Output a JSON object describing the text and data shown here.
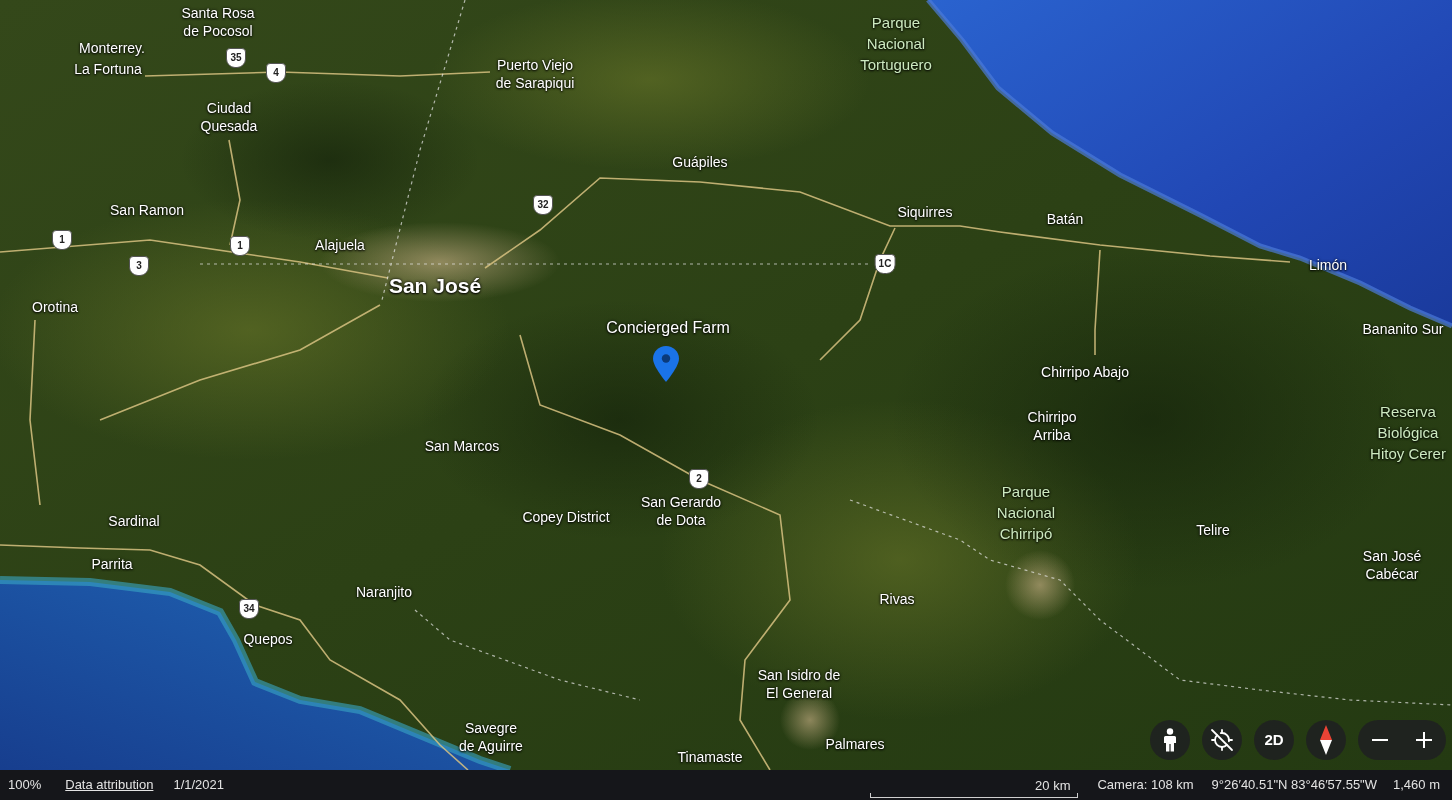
{
  "map": {
    "place_labels": [
      {
        "kind": "place",
        "lines": [
          "Santa Rosa",
          "de Pocosol"
        ]
      },
      {
        "kind": "place",
        "lines": [
          "Monterrey."
        ]
      },
      {
        "kind": "place",
        "lines": [
          "La Fortuna"
        ]
      },
      {
        "kind": "place",
        "lines": [
          "Puerto Viejo",
          "de Sarapiqui"
        ]
      },
      {
        "kind": "park",
        "lines": [
          "Parque",
          "Nacional",
          "Tortuguero"
        ]
      },
      {
        "kind": "place",
        "lines": [
          "Ciudad",
          "Quesada"
        ]
      },
      {
        "kind": "place",
        "lines": [
          "Guápiles"
        ]
      },
      {
        "kind": "place",
        "lines": [
          "San Ramon"
        ]
      },
      {
        "kind": "place",
        "lines": [
          "Siquirres"
        ]
      },
      {
        "kind": "place",
        "lines": [
          "Batán"
        ]
      },
      {
        "kind": "place",
        "lines": [
          "Alajuela"
        ]
      },
      {
        "kind": "place",
        "lines": [
          "Limón"
        ]
      },
      {
        "kind": "city",
        "lines": [
          "San José"
        ]
      },
      {
        "kind": "place",
        "lines": [
          "Orotina"
        ]
      },
      {
        "kind": "pinned",
        "lines": [
          "Concierged Farm"
        ]
      },
      {
        "kind": "place",
        "lines": [
          "Bananito Sur"
        ]
      },
      {
        "kind": "place",
        "lines": [
          "Chirripo Abajo"
        ]
      },
      {
        "kind": "place",
        "lines": [
          "San Marcos"
        ]
      },
      {
        "kind": "place",
        "lines": [
          "Chirripo",
          "Arriba"
        ]
      },
      {
        "kind": "park",
        "lines": [
          "Reserva",
          "Biológica",
          "Hitoy Cerer"
        ]
      },
      {
        "kind": "place",
        "lines": [
          "Sardinal"
        ]
      },
      {
        "kind": "place",
        "lines": [
          "Copey District"
        ]
      },
      {
        "kind": "place",
        "lines": [
          "San Gerardo",
          "de Dota"
        ]
      },
      {
        "kind": "park",
        "lines": [
          "Parque",
          "Nacional",
          "Chirripó"
        ]
      },
      {
        "kind": "place",
        "lines": [
          "Telire"
        ]
      },
      {
        "kind": "place",
        "lines": [
          "Parrita"
        ]
      },
      {
        "kind": "place",
        "lines": [
          "San José",
          "Cabécar"
        ]
      },
      {
        "kind": "place",
        "lines": [
          "Naranjito"
        ]
      },
      {
        "kind": "place",
        "lines": [
          "Rivas"
        ]
      },
      {
        "kind": "place",
        "lines": [
          "Quepos"
        ]
      },
      {
        "kind": "place",
        "lines": [
          "San Isidro de",
          "El General"
        ]
      },
      {
        "kind": "place",
        "lines": [
          "Savegre",
          "de Aguirre"
        ]
      },
      {
        "kind": "place",
        "lines": [
          "Palmares"
        ]
      },
      {
        "kind": "place",
        "lines": [
          "Tinamaste"
        ]
      }
    ],
    "route_shields": [
      "35",
      "4",
      "32",
      "1",
      "1",
      "3",
      "1C",
      "2",
      "34"
    ]
  },
  "map_controls": {
    "view_toggle": "2D"
  },
  "status_bar": {
    "zoom": "100%",
    "attribution_link": "Data attribution",
    "imagery_date": "1/1/2021",
    "scale": "20 km",
    "camera": "Camera: 108 km",
    "coordinates": "9°26′40.51\"N 83°46′57.55\"W",
    "elevation": "1,460 m"
  }
}
